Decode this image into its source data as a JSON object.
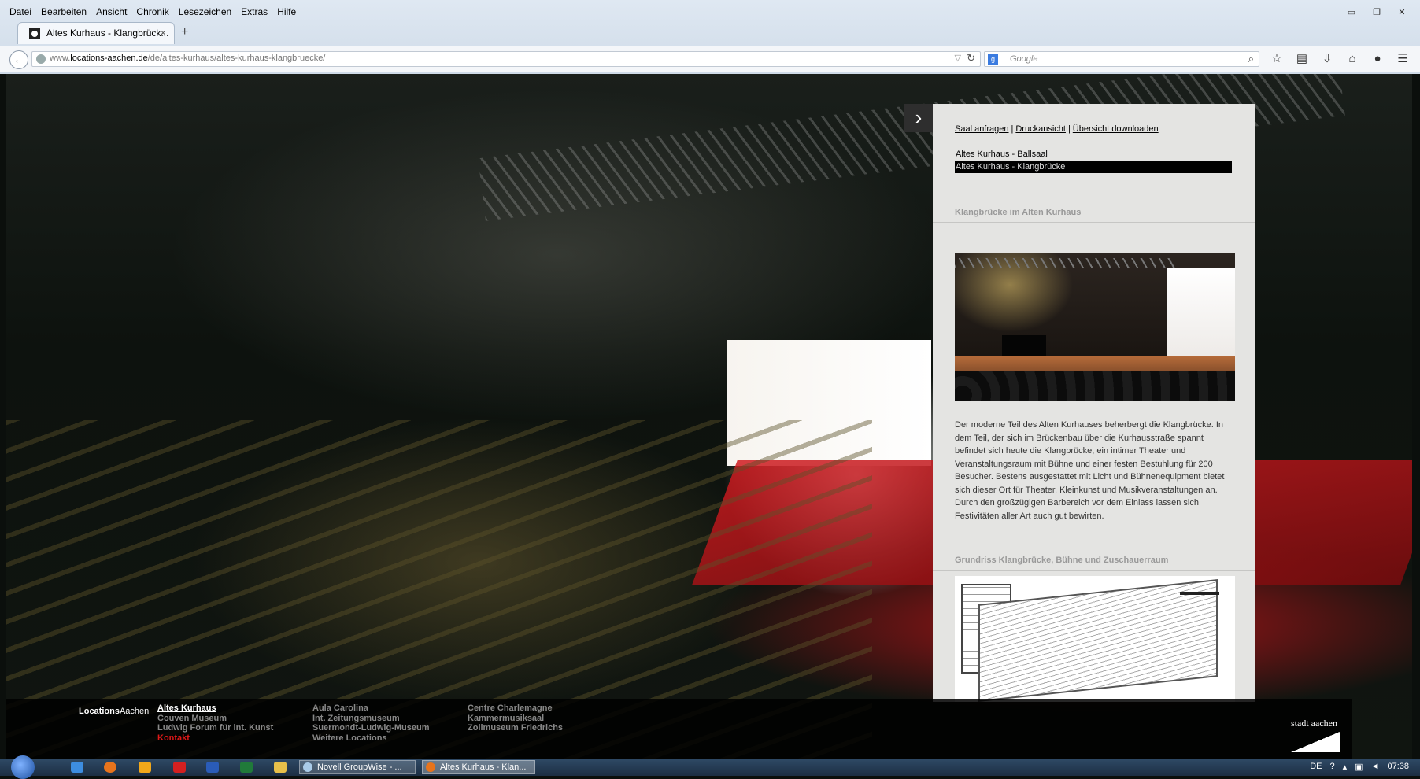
{
  "browser": {
    "menu": [
      "Datei",
      "Bearbeiten",
      "Ansicht",
      "Chronik",
      "Lesezeichen",
      "Extras",
      "Hilfe"
    ],
    "tab_title": "Altes Kurhaus - Klangbrück...",
    "url_prefix": "www.",
    "url_domain": "locations-aachen.de",
    "url_path": "/de/altes-kurhaus/altes-kurhaus-klangbruecke/",
    "search_placeholder": "Google"
  },
  "panel": {
    "links": [
      "Saal anfragen",
      "Druckansicht",
      "Übersicht downloaden"
    ],
    "sub_items": [
      "Altes Kurhaus - Ballsaal",
      "Altes Kurhaus - Klangbrücke"
    ],
    "section1_title": "Klangbrücke im Alten Kurhaus",
    "description": "Der moderne Teil des Alten Kurhauses beherbergt die Klangbrücke. In dem Teil, der sich im Brückenbau über die Kurhausstraße spannt befindet sich heute die Klangbrücke, ein intimer Theater und Veranstaltungsraum mit Bühne und einer festen Bestuhlung für 200 Besucher. Bestens ausgestattet mit Licht und Bühnenequipment bietet sich dieser Ort für Theater, Kleinkunst und Musikveranstaltungen an. Durch den großzügigen Barbereich vor dem Einlass lassen sich Festivitäten aller Art auch gut bewirten.",
    "section2_title": "Grundriss Klangbrücke, Bühne und Zuschauerraum"
  },
  "footer": {
    "brand_bold": "Locations",
    "brand_rest": "Aachen",
    "col1": [
      "Altes Kurhaus",
      "Couven Museum",
      "Ludwig Forum für int. Kunst",
      "Kontakt"
    ],
    "col2": [
      "Aula Carolina",
      "Int. Zeitungsmuseum",
      "Suermondt-Ludwig-Museum",
      "Weitere Locations"
    ],
    "col3": [
      "Centre Charlemagne",
      "Kammermusiksaal",
      "Zollmuseum Friedrichs"
    ],
    "logo_text": "stadt aachen"
  },
  "taskbar": {
    "tasks": [
      "Novell GroupWise - ...",
      "Altes Kurhaus - Klan..."
    ],
    "lang": "DE",
    "time": "07:38"
  }
}
